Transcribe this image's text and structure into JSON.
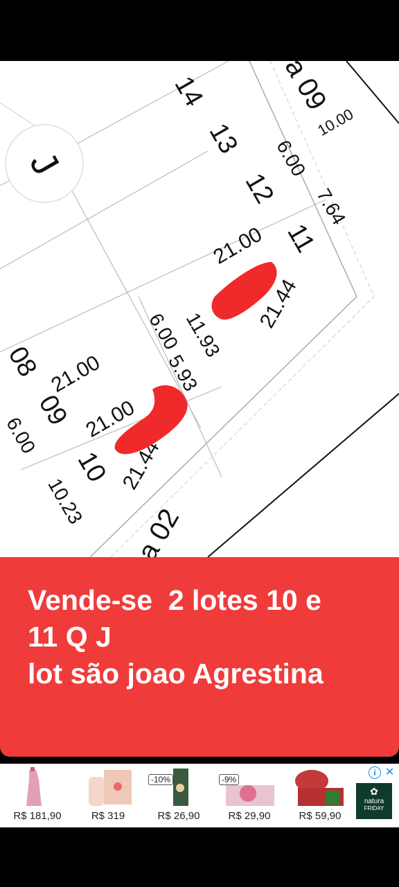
{
  "plan": {
    "block_letter": "J",
    "street_top": "a 09",
    "street_bottom": "a 02",
    "lot_numbers": [
      "14",
      "13",
      "12",
      "11",
      "08",
      "09",
      "10"
    ],
    "measure_top_right": "10.00",
    "measure_6_top": "6.00",
    "measure_764": "7.64",
    "measure_21_top": "21.00",
    "measure_2144_right": "21.44",
    "measure_1193": "11.93",
    "measure_6_mid": "6.00",
    "measure_593": "5.93",
    "measure_21_left": "21.00",
    "measure_21_mid": "21.00",
    "measure_2144_left": "21.44",
    "measure_6_left": "6.00",
    "measure_1023": "10.23"
  },
  "banner": {
    "text": "Vende-se  2 lotes 10 e\n11 Q J\nlot são joao Agrestina",
    "color": "#f03b3b"
  },
  "ads": {
    "items": [
      {
        "price": "R$ 181,90",
        "discount": ""
      },
      {
        "price": "R$ 319",
        "discount": ""
      },
      {
        "price": "R$ 26,90",
        "discount": "-10%"
      },
      {
        "price": "R$ 29,90",
        "discount": "-9%"
      },
      {
        "price": "R$ 59,90",
        "discount": ""
      }
    ],
    "brand": "natura",
    "brand_sub": "FRIDAY",
    "info_icon": "i",
    "close_icon": "✕"
  }
}
